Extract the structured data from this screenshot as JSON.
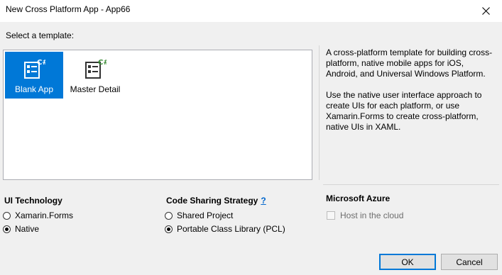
{
  "window": {
    "title": "New Cross Platform App - App66"
  },
  "prompt": "Select a template:",
  "templates": [
    {
      "label": "Blank App",
      "icon": "blank-app-icon",
      "selected": true
    },
    {
      "label": "Master Detail",
      "icon": "master-detail-icon",
      "selected": false
    }
  ],
  "description": {
    "paragraph1": "A cross-platform template for building cross-platform, native mobile apps for iOS, Android, and Universal Windows Platform.",
    "paragraph2": "Use the native user interface approach to create UIs for each platform, or use Xamarin.Forms to create cross-platform, native UIs in XAML."
  },
  "ui_technology": {
    "title": "UI Technology",
    "options": [
      {
        "label": "Xamarin.Forms",
        "selected": false
      },
      {
        "label": "Native",
        "selected": true
      }
    ]
  },
  "code_sharing": {
    "title": "Code Sharing Strategy",
    "help": "?",
    "options": [
      {
        "label": "Shared Project",
        "selected": false
      },
      {
        "label": "Portable Class Library (PCL)",
        "selected": true
      }
    ]
  },
  "azure": {
    "title": "Microsoft Azure",
    "host_label": "Host in the cloud",
    "host_checked": false
  },
  "buttons": {
    "ok": "OK",
    "cancel": "Cancel"
  },
  "colors": {
    "accent": "#0078d7",
    "csharp_badge": "#388a34"
  }
}
